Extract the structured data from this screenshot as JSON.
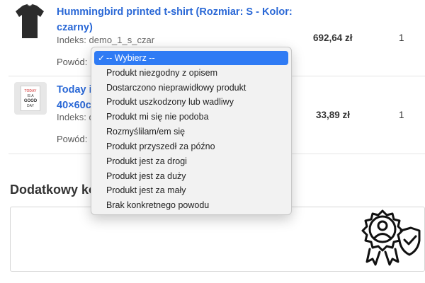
{
  "products": [
    {
      "name_line1": "Hummingbird printed t-shirt (Rozmiar: S - Kolor:",
      "name_line2": "czarny)",
      "reference": "Indeks: demo_1_s_czar",
      "reason_label": "Powód:",
      "price": "692,64 zł",
      "quantity": "1"
    },
    {
      "name_line1": "Today is",
      "name_line2": "40×60c",
      "reference": "Indeks: d",
      "reason_label": "Powód:",
      "price": "33,89 zł",
      "quantity": "1",
      "poster_text": [
        "TODAY",
        "IS A",
        "GOOD",
        "DAY"
      ]
    }
  ],
  "additional_comment_title": "Dodatkowy ko",
  "reason_dropdown": {
    "options": [
      "-- Wybierz --",
      "Produkt niezgodny z opisem",
      "Dostarczono nieprawidłowy produkt",
      "Produkt uszkodzony lub wadliwy",
      "Produkt mi się nie podoba",
      "Rozmyślilam/em się",
      "Produkt przyszedł za późno",
      "Produkt jest za drogi",
      "Produkt jest za duży",
      "Produkt jest za mały",
      "Brak konkretnego powodu"
    ],
    "selected_index": 0,
    "selected_mark": "✓",
    "highlight_color": "#2f7bf4"
  },
  "colors": {
    "link": "#2a68d6"
  }
}
